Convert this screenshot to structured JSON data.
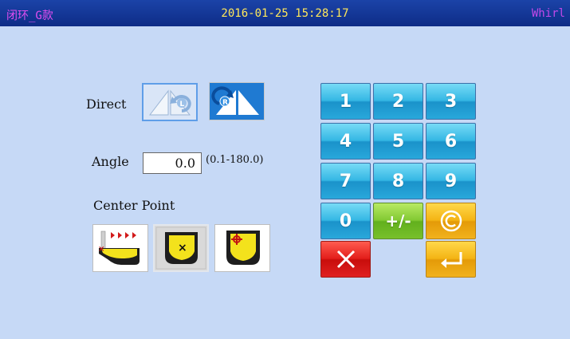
{
  "title_bar": {
    "pattern_name": "闭环_G款",
    "datetime": "2016-01-25 15:28:17",
    "mode": "Whirl"
  },
  "direction": {
    "label": "Direct",
    "options": [
      {
        "name": "counterclockwise",
        "icon": "rotate-left-icon",
        "selected": true
      },
      {
        "name": "clockwise",
        "icon": "rotate-right-icon",
        "selected": false
      }
    ]
  },
  "angle": {
    "label": "Angle",
    "value": "0.0",
    "range": "(0.1-180.0)"
  },
  "center_point": {
    "label": "Center Point",
    "options": [
      {
        "name": "start-point",
        "icon": "start-point-icon",
        "selected": false
      },
      {
        "name": "pattern-center",
        "icon": "pattern-center-icon",
        "selected": true
      },
      {
        "name": "custom-point",
        "icon": "custom-point-icon",
        "selected": false
      }
    ]
  },
  "keypad": {
    "keys": [
      "1",
      "2",
      "3",
      "4",
      "5",
      "6",
      "7",
      "8",
      "9",
      "0"
    ],
    "sign_label": "+/-",
    "clear_icon": "copyright-circle-icon",
    "cancel_icon": "close-icon",
    "enter_icon": "enter-icon"
  },
  "colors": {
    "background": "#c6d9f6",
    "titlebar": "#0e2c86",
    "title_name": "#e24df0",
    "title_datetime": "#ffe85a",
    "key_blue": "#29a8db",
    "key_green": "#78c02b",
    "key_orange": "#f1b21c",
    "key_red": "#e02020"
  }
}
